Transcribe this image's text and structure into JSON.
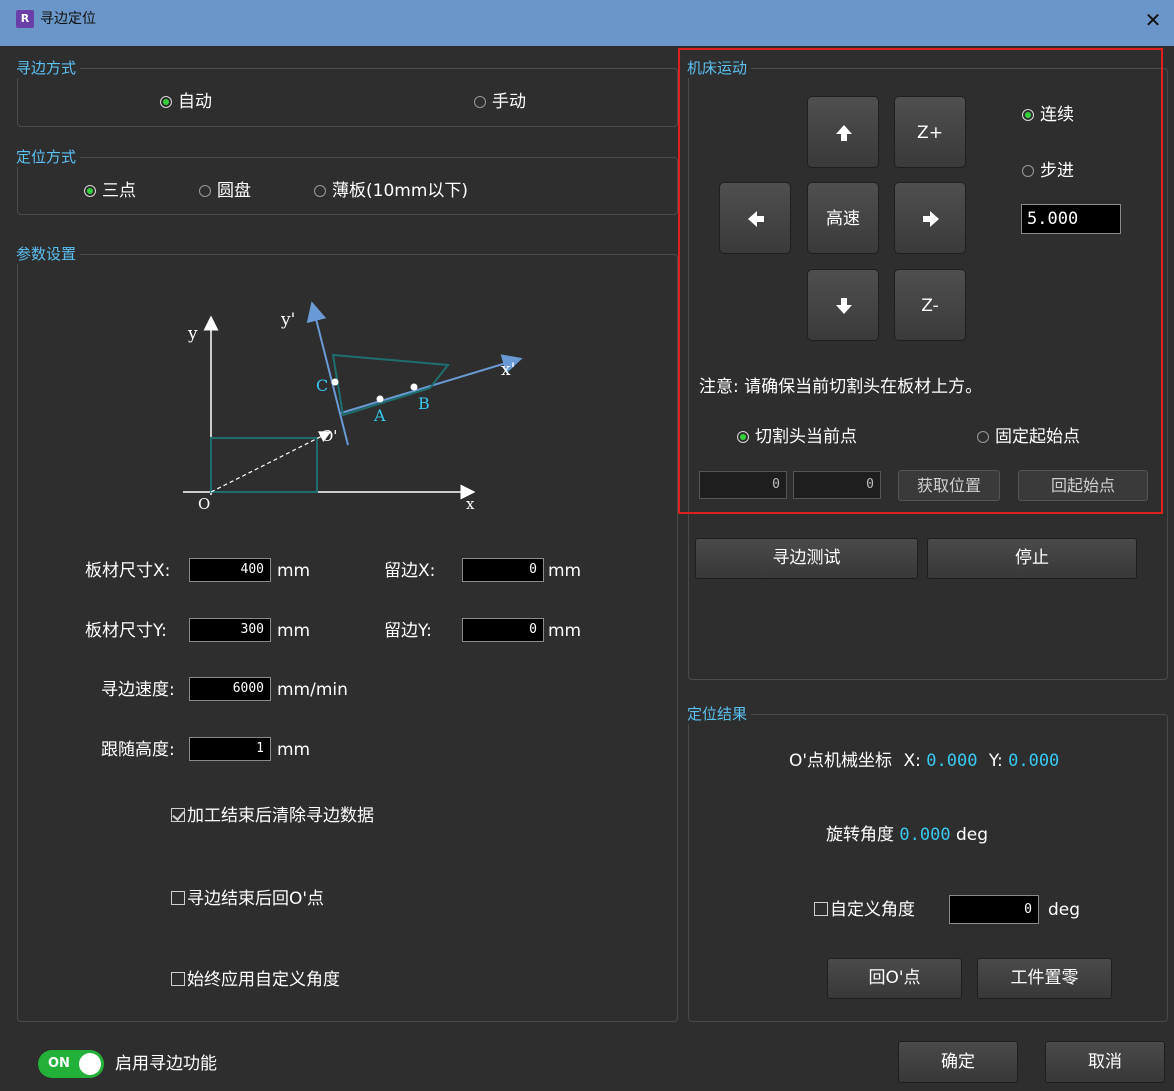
{
  "window": {
    "title": "寻边定位",
    "app_icon_glyph": "R"
  },
  "edge_mode": {
    "title": "寻边方式",
    "options": [
      {
        "label": "自动",
        "selected": true
      },
      {
        "label": "手动",
        "selected": false
      }
    ]
  },
  "position_mode": {
    "title": "定位方式",
    "options": [
      {
        "label": "三点",
        "selected": true
      },
      {
        "label": "圆盘",
        "selected": false
      },
      {
        "label": "薄板(10mm以下)",
        "selected": false
      }
    ]
  },
  "params": {
    "title": "参数设置",
    "diagram_labels": {
      "y": "y",
      "y_prime": "y'",
      "x": "x",
      "x_prime": "x'",
      "origin": "O",
      "origin_prime": "O'",
      "A": "A",
      "B": "B",
      "C": "C"
    },
    "board_x_label": "板材尺寸X:",
    "board_x_value": "400",
    "board_x_unit": "mm",
    "margin_x_label": "留边X:",
    "margin_x_value": "0",
    "margin_x_unit": "mm",
    "board_y_label": "板材尺寸Y:",
    "board_y_value": "300",
    "board_y_unit": "mm",
    "margin_y_label": "留边Y:",
    "margin_y_value": "0",
    "margin_y_unit": "mm",
    "speed_label": "寻边速度:",
    "speed_value": "6000",
    "speed_unit": "mm/min",
    "follow_label": "跟随高度:",
    "follow_value": "1",
    "follow_unit": "mm",
    "check_clear": {
      "label": "加工结束后清除寻边数据",
      "checked": true
    },
    "check_return": {
      "label": "寻边结束后回O'点",
      "checked": false
    },
    "check_custom_angle": {
      "label": "始终应用自定义角度",
      "checked": false
    }
  },
  "machine_motion": {
    "title": "机床运动",
    "z_plus": "Z+",
    "z_minus": "Z-",
    "high_speed": "高速",
    "mode_continuous": {
      "label": "连续",
      "selected": true
    },
    "mode_step": {
      "label": "步进",
      "selected": false
    },
    "step_value": "5.000",
    "note": "注意: 请确保当前切割头在板材上方。",
    "point_current": {
      "label": "切割头当前点",
      "selected": true
    },
    "point_fixed": {
      "label": "固定起始点",
      "selected": false
    },
    "coord_x": "0",
    "coord_y": "0",
    "get_position": "获取位置",
    "return_start": "回起始点"
  },
  "actions": {
    "edge_test": "寻边测试",
    "stop": "停止"
  },
  "result": {
    "title": "定位结果",
    "coord_label": "O'点机械坐标",
    "x_label": "X:",
    "x_value": "0.000",
    "y_label": "Y:",
    "y_value": "0.000",
    "angle_label": "旋转角度",
    "angle_value": "0.000",
    "angle_unit": "deg",
    "custom_angle": {
      "label": "自定义角度",
      "checked": false
    },
    "custom_angle_value": "0",
    "custom_angle_unit": "deg",
    "return_origin": "回O'点",
    "workpiece_zero": "工件置零"
  },
  "footer": {
    "toggle_text": "ON",
    "toggle_on": true,
    "enable_label": "启用寻边功能",
    "ok": "确定",
    "cancel": "取消"
  }
}
